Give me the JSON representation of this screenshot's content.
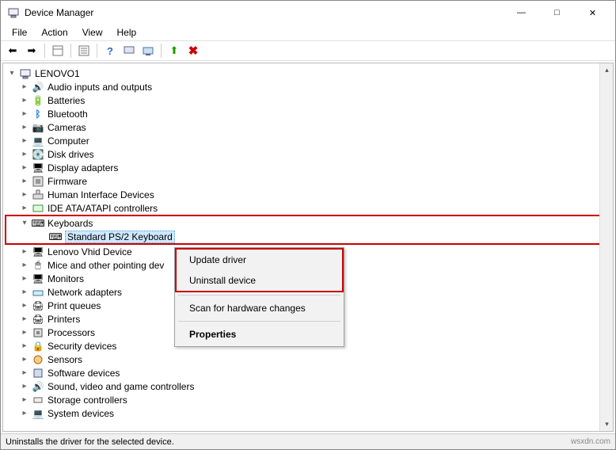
{
  "title": "Device Manager",
  "menu": {
    "file": "File",
    "action": "Action",
    "view": "View",
    "help": "Help"
  },
  "root": "LENOVO1",
  "nodes": {
    "audio": "Audio inputs and outputs",
    "batteries": "Batteries",
    "bluetooth": "Bluetooth",
    "cameras": "Cameras",
    "computer": "Computer",
    "diskdrives": "Disk drives",
    "display": "Display adapters",
    "firmware": "Firmware",
    "hid": "Human Interface Devices",
    "ide": "IDE ATA/ATAPI controllers",
    "keyboards": "Keyboards",
    "kb_child": "Standard PS/2 Keyboard",
    "lenovo": "Lenovo Vhid Device",
    "mice": "Mice and other pointing dev",
    "monitors": "Monitors",
    "network": "Network adapters",
    "printq": "Print queues",
    "printers": "Printers",
    "processors": "Processors",
    "security": "Security devices",
    "sensors": "Sensors",
    "software": "Software devices",
    "sound": "Sound, video and game controllers",
    "storage": "Storage controllers",
    "system": "System devices"
  },
  "ctx": {
    "update": "Update driver",
    "uninstall": "Uninstall device",
    "scan": "Scan for hardware changes",
    "props": "Properties"
  },
  "status": "Uninstalls the driver for the selected device.",
  "watermark": "wsxdn.com"
}
